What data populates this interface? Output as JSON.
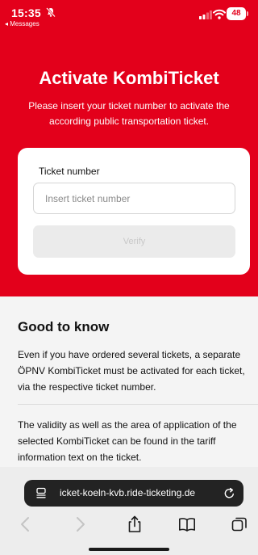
{
  "status_bar": {
    "time": "15:35",
    "back_app": "◂ Messages",
    "battery": "48"
  },
  "header": {
    "title": "Activate KombiTicket",
    "subtitle": "Please insert your ticket number to activate the according public transportation ticket."
  },
  "form": {
    "field_label": "Ticket number",
    "placeholder": "Insert ticket number",
    "verify_label": "Verify"
  },
  "info": {
    "title": "Good to know",
    "paragraph_1": "Even if you have ordered several tickets, a separate ÖPNV KombiTicket must be activated for each ticket, via the respective ticket number.",
    "paragraph_2": "The validity as well as the area of application of the selected KombiTicket can be found in the tariff information text on the ticket."
  },
  "browser": {
    "url": "icket-koeln-kvb.ride-ticketing.de"
  },
  "colors": {
    "brand_red": "#e3001b",
    "background": "#f4f4f4"
  }
}
